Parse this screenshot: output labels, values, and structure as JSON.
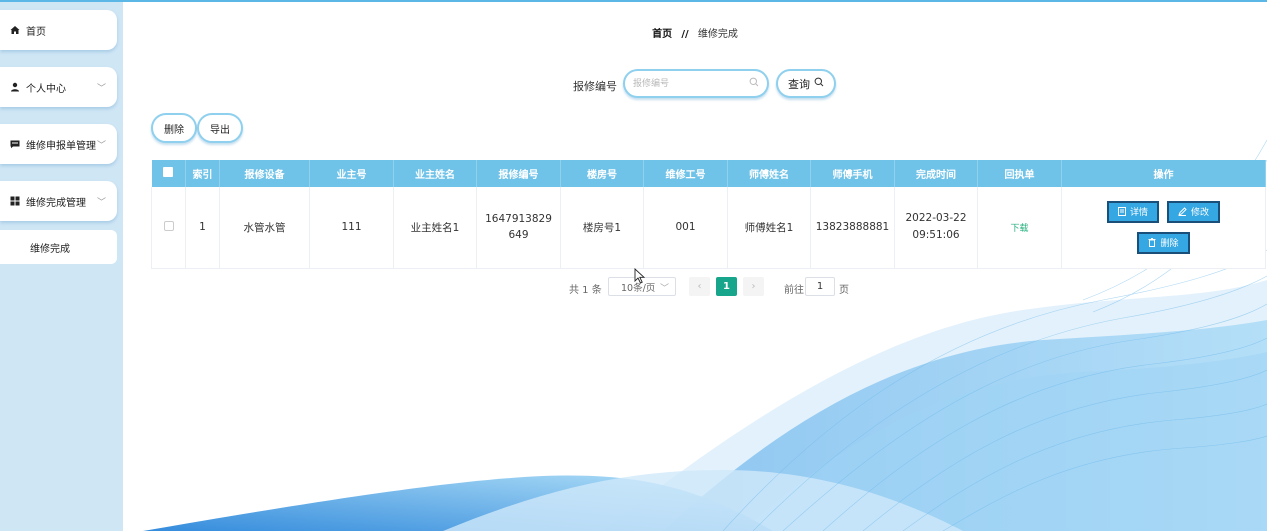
{
  "sidebar": {
    "items": [
      {
        "label": "首页"
      },
      {
        "label": "个人中心"
      },
      {
        "label": "维修申报单管理"
      },
      {
        "label": "维修完成管理"
      }
    ],
    "sub_item": "维修完成"
  },
  "breadcrumb": {
    "home": "首页",
    "separator": "//",
    "current": "维修完成"
  },
  "search": {
    "label": "报修编号",
    "placeholder": "报修编号",
    "value": "",
    "button_label": "查询"
  },
  "actions": {
    "delete_label": "删除",
    "export_label": "导出"
  },
  "table": {
    "headers": [
      "索引",
      "报修设备",
      "业主号",
      "业主姓名",
      "报修编号",
      "楼房号",
      "维修工号",
      "师傅姓名",
      "师傅手机",
      "完成时间",
      "回执单",
      "操作"
    ],
    "rows": [
      {
        "index": "1",
        "device": "水管水管",
        "owner_no": "111",
        "owner_name": "业主姓名1",
        "repair_no": "1647913829649",
        "building": "楼房号1",
        "worker_no": "001",
        "master_name": "师傅姓名1",
        "master_phone": "13823888881",
        "finish_time": "2022-03-22 09:51:06",
        "receipt": "下载",
        "ops": {
          "detail": "详情",
          "edit": "修改",
          "delete": "删除"
        }
      }
    ]
  },
  "pagination": {
    "total": "共 1 条",
    "page_size": "10条/页",
    "current_page": "1",
    "goto_label": "前往",
    "goto_value": "1",
    "page_suffix": "页"
  },
  "colors": {
    "sidebar_bg": "#cfe6f5",
    "table_header": "#6fc2e8",
    "button_blue": "#35a7e2",
    "pagination_active": "#17a58b",
    "pill_border": "#8fd0ee"
  }
}
